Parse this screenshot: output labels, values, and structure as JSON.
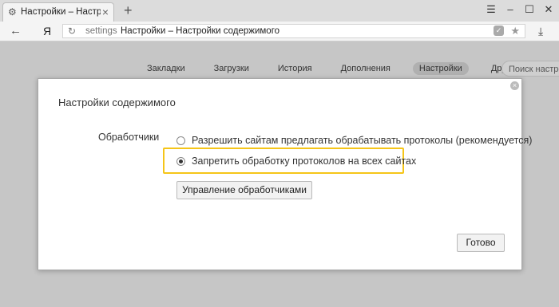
{
  "browser": {
    "tab": {
      "title": "Настройки – Настройки",
      "icon": "gear-icon"
    },
    "window_controls": [
      "☰",
      "–",
      "☐",
      "✕"
    ],
    "address_bar": {
      "host": "settings",
      "title": "Настройки – Настройки содержимого"
    },
    "ya_button": "Я"
  },
  "settings_nav": {
    "items": [
      "Закладки",
      "Загрузки",
      "История",
      "Дополнения",
      "Настройки",
      "Другие устройства"
    ],
    "active": "Настройки",
    "search_placeholder": "Поиск настроек"
  },
  "dialog": {
    "title": "Настройки содержимого",
    "section_label": "Обработчики",
    "options": [
      {
        "label": "Разрешить сайтам предлагать обрабатывать протоколы (рекомендуется)",
        "checked": false
      },
      {
        "label": "Запретить обработку протоколов на всех сайтах",
        "checked": true
      }
    ],
    "manage_button": "Управление обработчиками",
    "done_button": "Готово",
    "highlight_color": "#f5c518"
  }
}
